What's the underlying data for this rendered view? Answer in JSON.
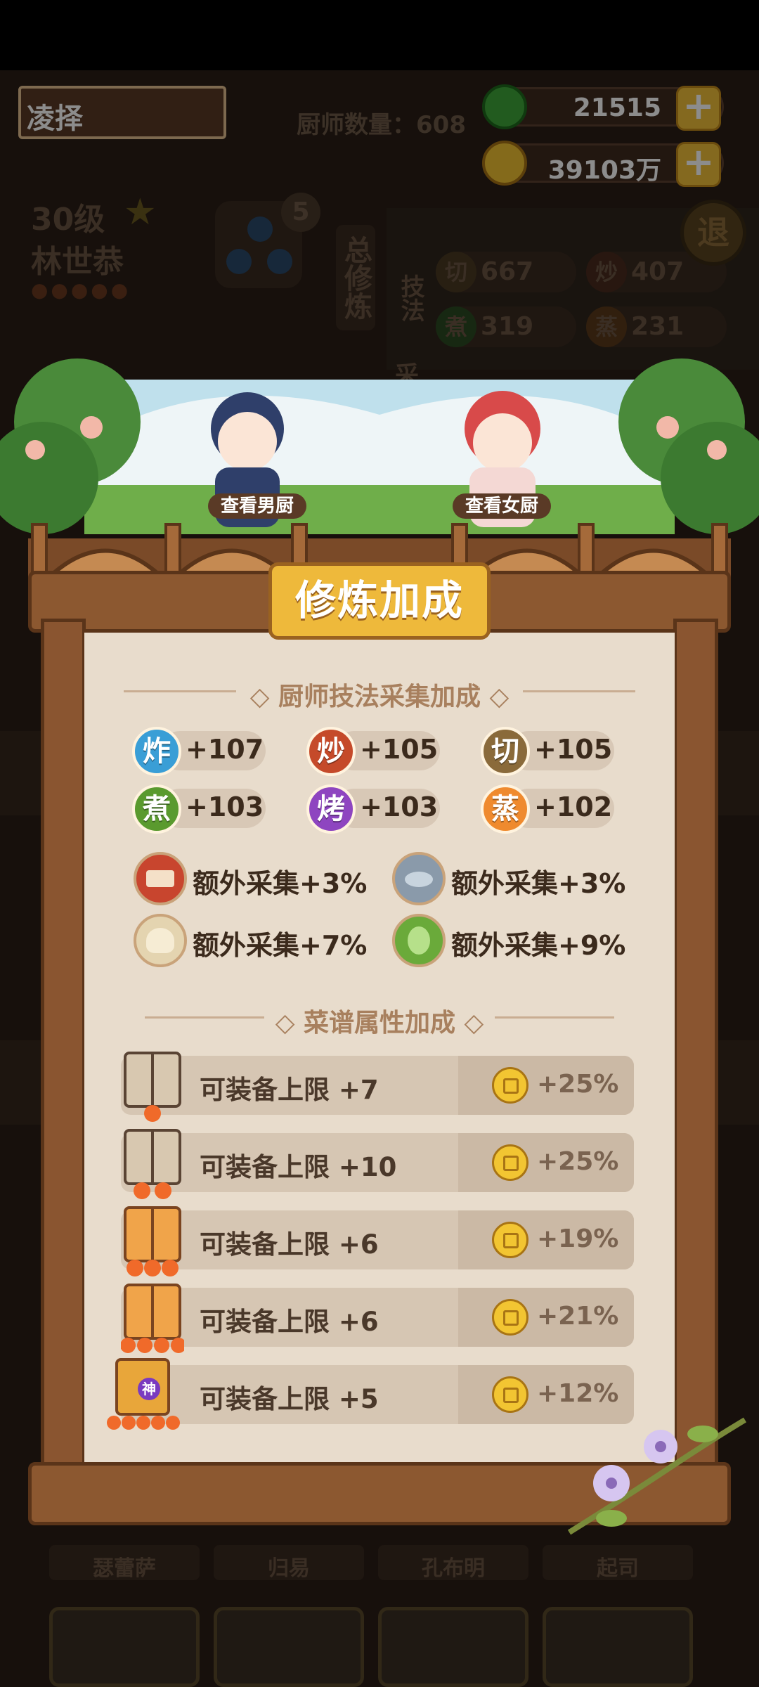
{
  "hud": {
    "player_name": "凌择",
    "chef_count_label": "厨师数量：608",
    "jade_amount": "21515",
    "gold_amount": "39103万"
  },
  "background": {
    "chef_level": "30级",
    "chef_name": "林世恭",
    "star_count_badge": "5",
    "tab_label": "总修炼",
    "side_label_1": "技法",
    "side_label_2": "采",
    "stats": [
      {
        "icon": "切",
        "value": "667"
      },
      {
        "icon": "炒",
        "value": "407"
      },
      {
        "icon": "煮",
        "value": "319"
      },
      {
        "icon": "蒸",
        "value": "231"
      }
    ],
    "bottom_names": [
      "瑟蕾萨",
      "归易",
      "孔布明",
      "起司"
    ],
    "back_label": "退"
  },
  "scene": {
    "view_male": "查看男厨",
    "view_female": "查看女厨"
  },
  "modal": {
    "title": "修炼加成",
    "skills_section": "厨师技法采集加成",
    "skills": [
      {
        "icon": "炸",
        "value": "+107",
        "color": "#3a9ed6"
      },
      {
        "icon": "炒",
        "value": "+105",
        "color": "#c54a2a"
      },
      {
        "icon": "切",
        "value": "+105",
        "color": "#8a6a3a"
      },
      {
        "icon": "煮",
        "value": "+103",
        "color": "#5a9a2e"
      },
      {
        "icon": "烤",
        "value": "+103",
        "color": "#8e45c0"
      },
      {
        "icon": "蒸",
        "value": "+102",
        "color": "#ef8a2e"
      }
    ],
    "extras": [
      {
        "icon": "meat-icon",
        "text": "额外采集+3%"
      },
      {
        "icon": "fish-icon",
        "text": "额外采集+3%"
      },
      {
        "icon": "flour-icon",
        "text": "额外采集+7%"
      },
      {
        "icon": "vegetable-icon",
        "text": "额外采集+9%"
      }
    ],
    "recipe_section": "菜谱属性加成",
    "recipe_rows": [
      {
        "label": "可装备上限 +7",
        "percent": "+25%",
        "flames": 1
      },
      {
        "label": "可装备上限 +10",
        "percent": "+25%",
        "flames": 2
      },
      {
        "label": "可装备上限 +6",
        "percent": "+19%",
        "flames": 3
      },
      {
        "label": "可装备上限 +6",
        "percent": "+21%",
        "flames": 4
      },
      {
        "label": "可装备上限 +5",
        "percent": "+12%",
        "flames": 5
      }
    ],
    "god_badge": "神"
  }
}
